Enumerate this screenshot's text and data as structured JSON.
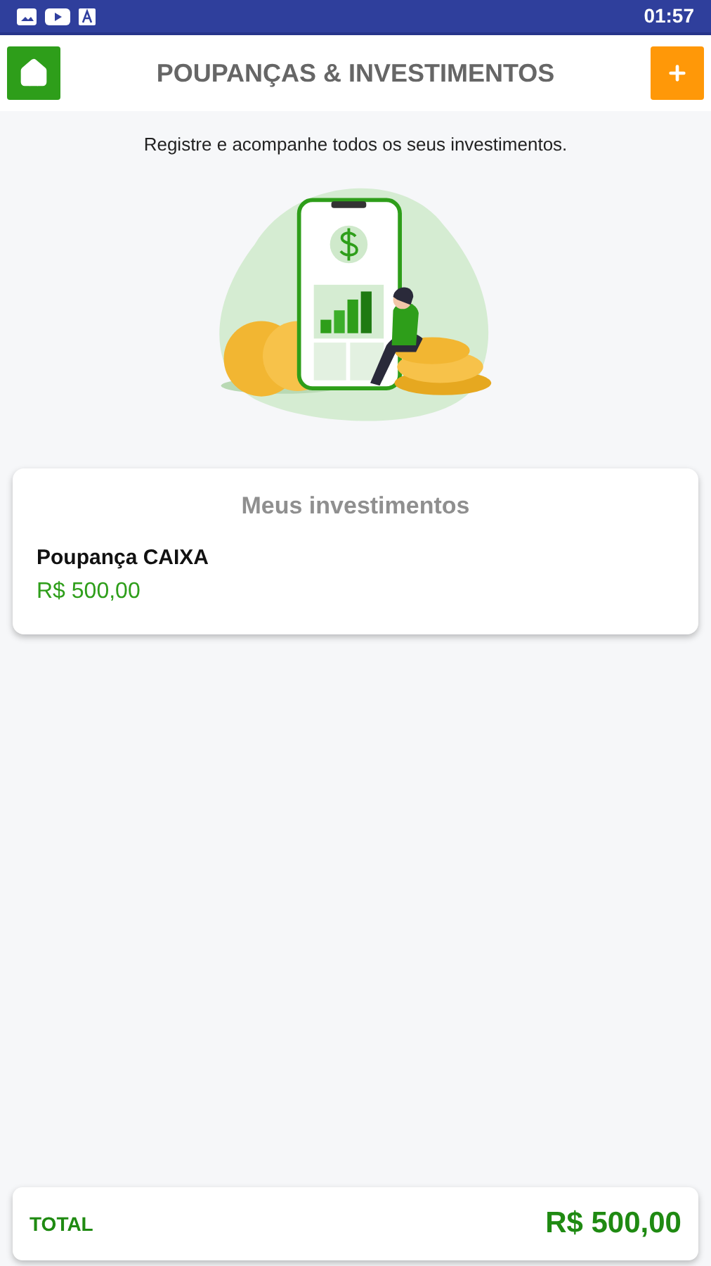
{
  "status_bar": {
    "time": "01:57"
  },
  "header": {
    "title": "POUPANÇAS & INVESTIMENTOS"
  },
  "subtitle": "Registre e acompanhe todos os seus investimentos.",
  "investments": {
    "title": "Meus investimentos",
    "items": [
      {
        "name": "Poupança CAIXA",
        "amount": "R$ 500,00"
      }
    ]
  },
  "total": {
    "label": "TOTAL",
    "amount": "R$ 500,00"
  }
}
